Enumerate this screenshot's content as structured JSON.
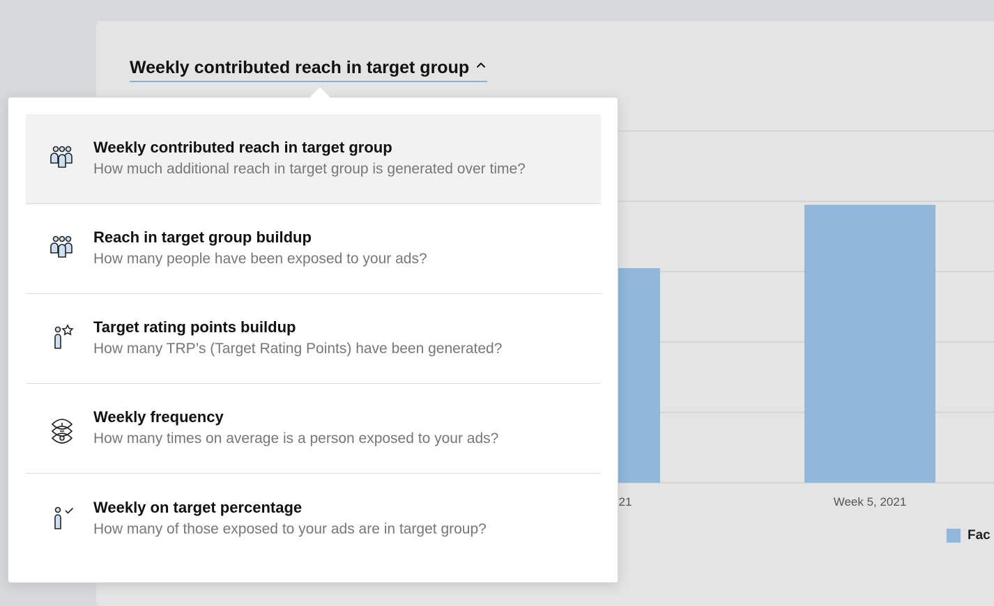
{
  "dropdown": {
    "selected_label": "Weekly contributed reach in target group",
    "options": [
      {
        "title": "Weekly contributed reach in target group",
        "description": "How much additional reach in target group is generated over time?",
        "icon": "group-icon",
        "selected": true
      },
      {
        "title": "Reach in target group buildup",
        "description": "How many people have been exposed to your ads?",
        "icon": "group-icon",
        "selected": false
      },
      {
        "title": "Target rating points buildup",
        "description": "How many TRP’s (Target Rating Points) have been generated?",
        "icon": "person-star-icon",
        "selected": false
      },
      {
        "title": "Weekly frequency",
        "description": "How many times on average is a person exposed to your ads?",
        "icon": "frequency-icon",
        "selected": false
      },
      {
        "title": "Weekly on target percentage",
        "description": "How many of those exposed to your ads are in target group?",
        "icon": "person-check-icon",
        "selected": false
      }
    ]
  },
  "chart_data": {
    "type": "bar",
    "categories": [
      "21",
      "Week 5, 2021"
    ],
    "series": [
      {
        "name": "Fac",
        "values": [
          0.61,
          0.79
        ],
        "color": "#8fb8da"
      }
    ],
    "ylim": [
      0,
      1
    ],
    "grid": true
  }
}
